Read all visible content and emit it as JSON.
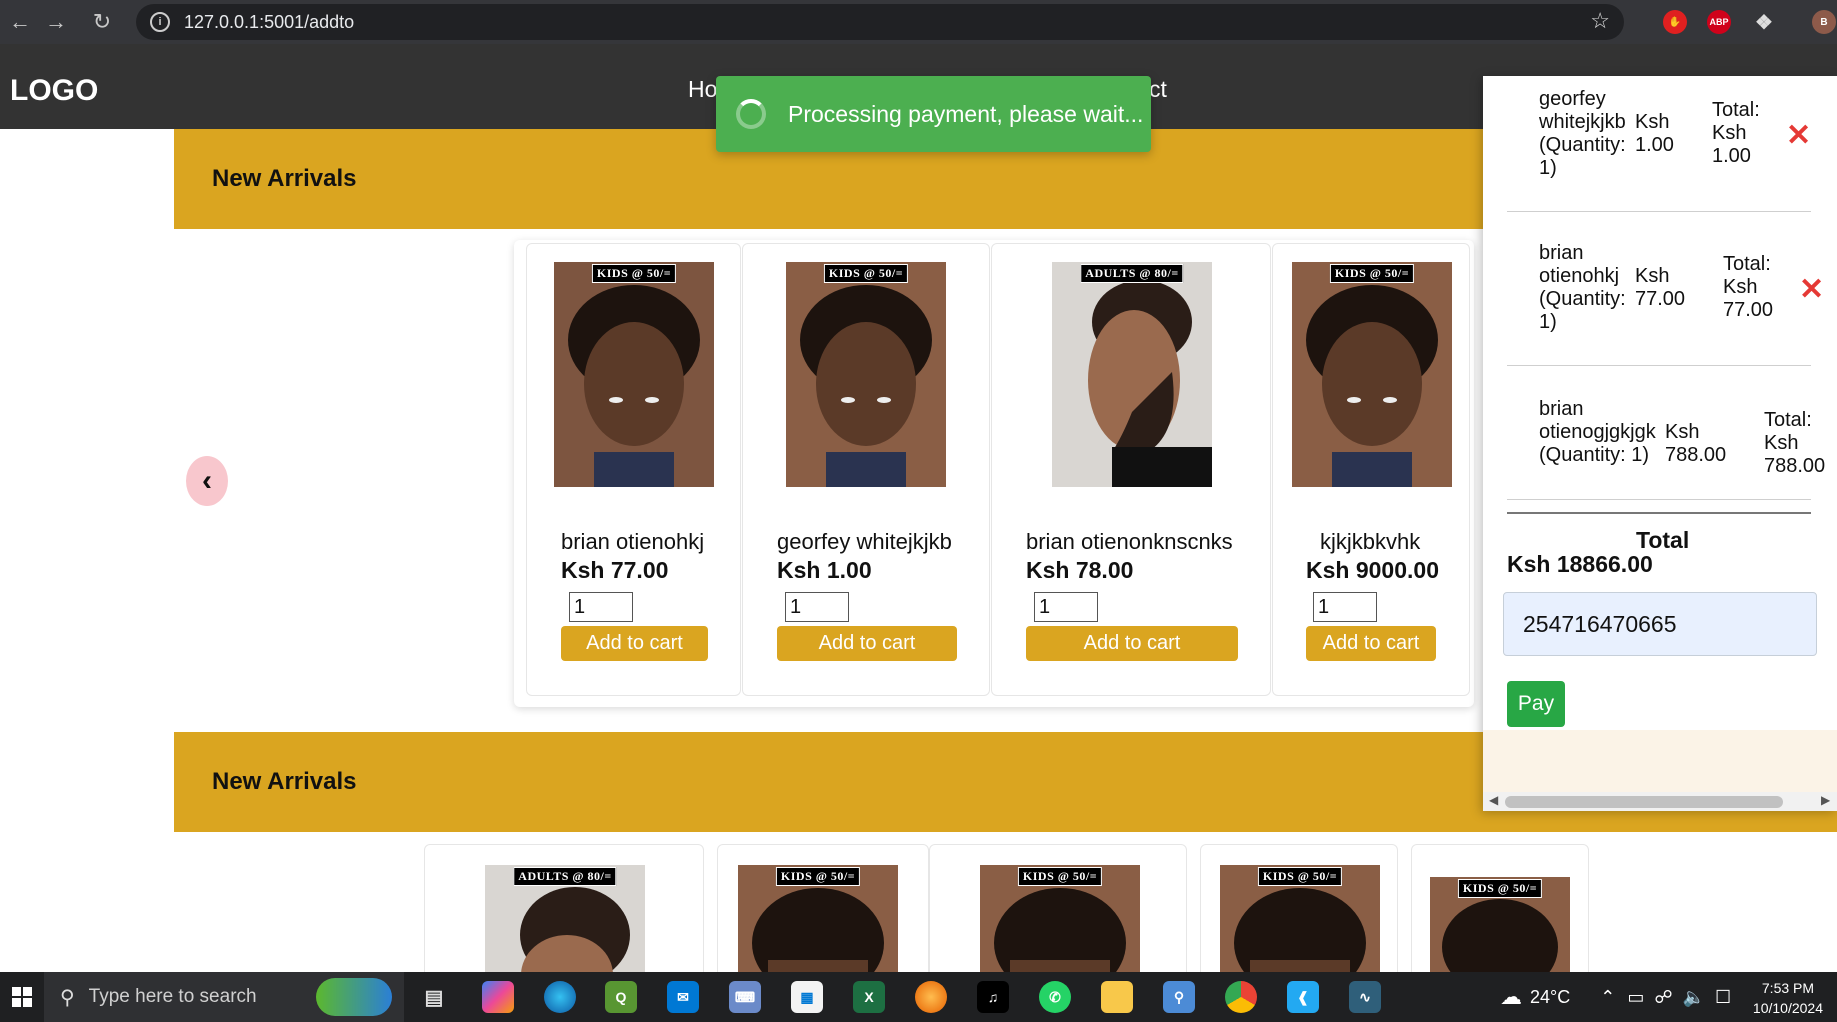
{
  "browser": {
    "url": "127.0.0.1:5001/addto",
    "extension_abp_label": "ABP",
    "profile_initial": "B"
  },
  "site": {
    "logo": "LOGO",
    "menu_fragment_left": "Ho",
    "menu_fragment_right": "ct"
  },
  "toast": {
    "message": "Processing payment, please wait..."
  },
  "sections": [
    {
      "title": "New Arrivals"
    },
    {
      "title": "New Arrivals"
    }
  ],
  "products": [
    {
      "tag": "KIDS @ 50/=",
      "name": "brian otienohkj",
      "price": "Ksh 77.00",
      "qty": "1",
      "button": "Add to cart",
      "image": "kid-haircut"
    },
    {
      "tag": "KIDS @ 50/=",
      "name": "georfey whitejkjkb",
      "price": "Ksh 1.00",
      "qty": "1",
      "button": "Add to cart",
      "image": "kid-haircut"
    },
    {
      "tag": "ADULTS @ 80/=",
      "name": "brian otienonknscnks",
      "price": "Ksh 78.00",
      "qty": "1",
      "button": "Add to cart",
      "image": "adult-haircut"
    },
    {
      "tag": "KIDS @ 50/=",
      "name": "kjkjkbkvhk",
      "price": "Ksh 9000.00",
      "qty": "1",
      "button": "Add to cart",
      "image": "kid-haircut"
    }
  ],
  "second_row_tags": [
    "ADULTS @ 80/=",
    "KIDS @ 50/=",
    "KIDS @ 50/=",
    "KIDS @ 50/=",
    "KIDS @ 50/="
  ],
  "cart": {
    "items": [
      {
        "name_lines": [
          "georfey",
          "whitejkjkb",
          "(Quantity:",
          "1)"
        ],
        "price_lines": [
          "Ksh",
          "1.00"
        ],
        "total_lines": [
          "Total:",
          "Ksh",
          "1.00"
        ]
      },
      {
        "name_lines": [
          "brian",
          "otienohkj",
          "(Quantity:",
          "1)"
        ],
        "price_lines": [
          "Ksh",
          "77.00"
        ],
        "total_lines": [
          "Total:",
          "Ksh",
          "77.00"
        ]
      },
      {
        "name_lines": [
          "brian",
          "otienogjgkjgk",
          "(Quantity: 1)"
        ],
        "price_lines": [
          "Ksh",
          "788.00"
        ],
        "total_lines": [
          "Total:",
          "Ksh",
          "788.00"
        ]
      }
    ],
    "total_label": "Total",
    "total_amount": "Ksh 18866.00",
    "phone_value": "254716470665",
    "pay_label": "Pay"
  },
  "taskbar": {
    "search_placeholder": "Type here to search",
    "weather": "24°C",
    "time": "7:53 PM",
    "date": "10/10/2024"
  },
  "colors": {
    "gold": "#daa520",
    "toast_green": "#4caf50",
    "pay_green": "#28a745",
    "remove_red": "#e53935",
    "header_dark": "#333333"
  }
}
